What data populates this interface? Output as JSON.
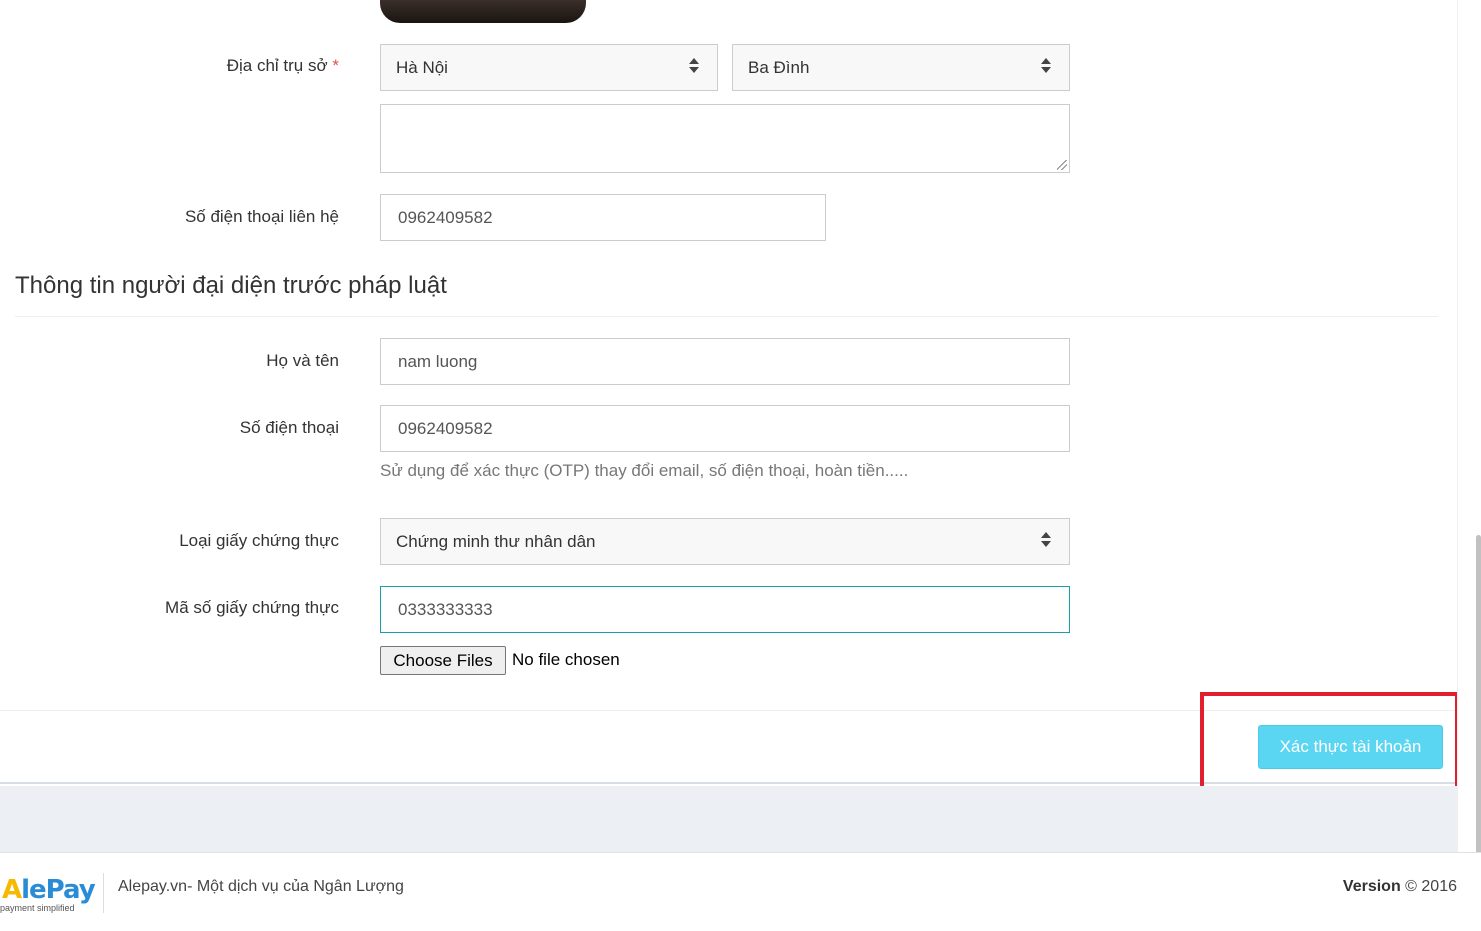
{
  "address": {
    "label": "Địa chỉ trụ sở",
    "required_mark": "*",
    "province": "Hà Nội",
    "district": "Ba Đình",
    "street_value": ""
  },
  "contact_phone": {
    "label": "Số điện thoại liên hệ",
    "value": "0962409582"
  },
  "legal_rep_section": {
    "title": "Thông tin người đại diện trước pháp luật"
  },
  "full_name": {
    "label": "Họ và tên",
    "value": "nam luong"
  },
  "phone": {
    "label": "Số điện thoại",
    "value": "0962409582",
    "help": "Sử dụng để xác thực (OTP) thay đổi email, số điện thoại, hoàn tiền....."
  },
  "id_type": {
    "label": "Loại giấy chứng thực",
    "value": "Chứng minh thư nhân dân"
  },
  "id_number": {
    "label": "Mã số giấy chứng thực",
    "value": "0333333333"
  },
  "file_upload": {
    "button_label": "Choose Files",
    "status": "No file chosen"
  },
  "submit": {
    "label": "Xác thực tài khoản"
  },
  "footer": {
    "logo_text_a": "A",
    "logo_text_rest": "lePay",
    "logo_tagline": "payment simplified",
    "text": "Alepay.vn- Một dịch vụ của Ngân Lượng",
    "version_label": "Version",
    "version_copy": "© 2016"
  },
  "colors": {
    "submit_bg": "#5bd6f2",
    "highlight": "#e0202c",
    "focus_border": "#1a9fa8"
  }
}
